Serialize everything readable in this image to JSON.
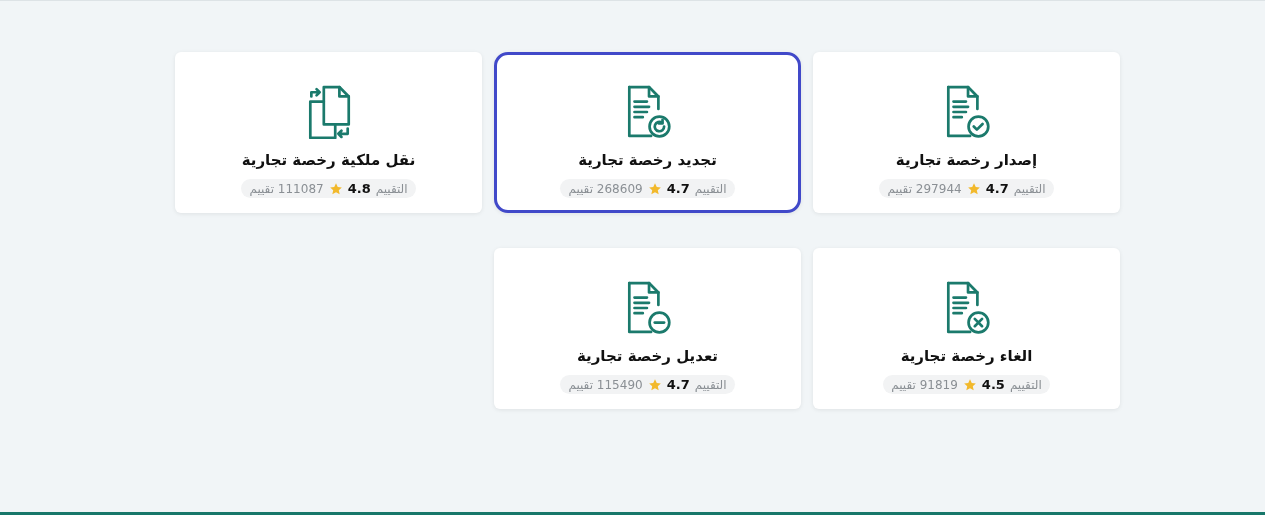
{
  "services": [
    {
      "title": "إصدار رخصة تجارية",
      "kind": "check",
      "selected": false,
      "rating_label": "التقييم",
      "score": "4.7",
      "count": "297944 تقييم"
    },
    {
      "title": "تجديد رخصة تجارية",
      "kind": "renew",
      "selected": true,
      "rating_label": "التقييم",
      "score": "4.7",
      "count": "268609 تقييم"
    },
    {
      "title": "نقل ملكية رخصة تجارية",
      "kind": "transfer",
      "selected": false,
      "rating_label": "التقييم",
      "score": "4.8",
      "count": "111087 تقييم"
    },
    {
      "title": "الغاء رخصة تجارية",
      "kind": "cancel",
      "selected": false,
      "rating_label": "التقييم",
      "score": "4.5",
      "count": "91819 تقييم"
    },
    {
      "title": "تعديل رخصة تجارية",
      "kind": "minus",
      "selected": false,
      "rating_label": "التقييم",
      "score": "4.7",
      "count": "115490 تقييم"
    }
  ]
}
